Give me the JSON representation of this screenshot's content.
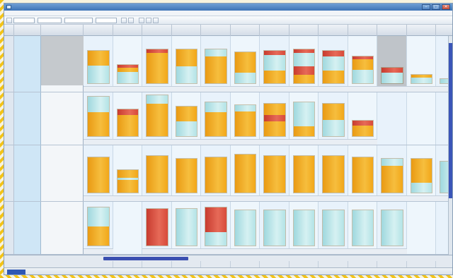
{
  "window": {
    "title": ""
  },
  "menu": {
    "items": []
  },
  "toolbar": {
    "combos": [
      {
        "name": "view-combo",
        "value": ""
      },
      {
        "name": "period-combo",
        "value": ""
      },
      {
        "name": "filter-combo",
        "value": ""
      },
      {
        "name": "group-combo",
        "value": ""
      }
    ]
  },
  "columns": {
    "row_head": "",
    "name_head": "",
    "info_head": "",
    "days": [
      "",
      "",
      "",
      "",
      "",
      "",
      "",
      "",
      "",
      "",
      "",
      "",
      ""
    ]
  },
  "lanes": [
    {
      "label": "",
      "num": ""
    },
    {
      "label": "",
      "num": ""
    },
    {
      "label": "",
      "num": ""
    },
    {
      "label": "",
      "num": ""
    }
  ],
  "status": {
    "left": "",
    "mid": "",
    "right": ""
  },
  "colors": {
    "orange": "#f2a719",
    "cyan": "#b3e3e6",
    "red": "#d84a3a",
    "accent": "#3a55b8"
  }
}
